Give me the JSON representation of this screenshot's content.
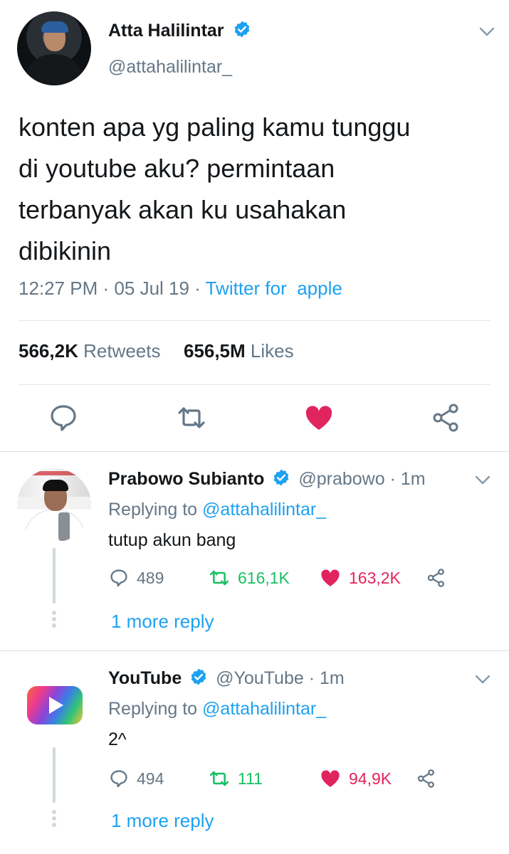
{
  "tweet": {
    "author_name": "Atta Halilintar",
    "author_handle": "@attahalilintar_",
    "text_lines": [
      "konten apa yg paling kamu tunggu",
      "di youtube aku? permintaan",
      "terbanyak akan ku usahakan",
      "dibikinin"
    ],
    "time": "12:27 PM",
    "date": "05 Jul 19",
    "source": "Twitter for  apple",
    "retweets_count": "566,2K",
    "retweets_label": "Retweets",
    "likes_count": "656,5M",
    "likes_label": "Likes",
    "liked": true
  },
  "replies": [
    {
      "name": "Prabowo Subianto",
      "handle": "@prabowo",
      "time": "1m",
      "replying_label": "Replying to",
      "replying_to": "@attahalilintar_",
      "text": "tutup akun bang",
      "comments": "489",
      "retweets": "616,1K",
      "likes": "163,2K",
      "more_reply": "1 more reply"
    },
    {
      "name": "YouTube",
      "handle": "@YouTube",
      "time": "1m",
      "replying_label": "Replying to",
      "replying_to": "@attahalilintar_",
      "text": "2^",
      "comments": "494",
      "retweets": "111",
      "likes": "94,9K",
      "more_reply": "1 more reply"
    }
  ],
  "colors": {
    "accent": "#1da1f2",
    "like": "#e0245e",
    "retweet": "#17bf63",
    "muted": "#657786"
  },
  "icons": [
    "verified-badge-icon",
    "chevron-down-icon",
    "reply-icon",
    "retweet-icon",
    "heart-icon",
    "share-icon"
  ]
}
